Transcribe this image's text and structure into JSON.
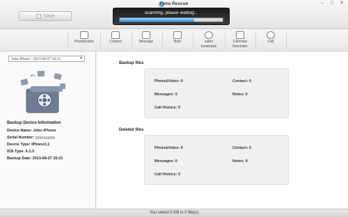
{
  "window": {
    "title": "Fone Rescue",
    "minimize": "–",
    "maximize": "□",
    "close": "✕"
  },
  "save_button": {
    "label": "Save",
    "icon": "save-icon"
  },
  "scan": {
    "status": "scanning, please waiting...",
    "progress": 0.72
  },
  "toolbar": [
    {
      "label": "Photo&video",
      "icon": "photo-video-icon"
    },
    {
      "label": "Contact",
      "icon": "contact-icon"
    },
    {
      "label": "Message",
      "icon": "message-icon"
    },
    {
      "label": "Note",
      "icon": "note-icon"
    },
    {
      "label": "safari\nbookmark",
      "icon": "safari-bookmark-icon"
    },
    {
      "label": "Calendar\nReminder",
      "icon": "calendar-icon"
    },
    {
      "label": "Call",
      "icon": "call-icon"
    }
  ],
  "device": {
    "selected": "John iPhone - 2013-08-27 16:21",
    "info_title": "Backup Device Information",
    "name_label": "Device Name:",
    "name_value": "John iPhone",
    "serial_label": "Serial Number:",
    "type_label": "Devcie Type:",
    "type_value": "iPhone3,1",
    "ios_label": "IOS Type:",
    "ios_value": "6.1.3",
    "date_label": "Backup Date:",
    "date_value": "2013-08-27 16:21"
  },
  "backup": {
    "title": "Backup files",
    "photo": "Photo&Video: 0",
    "contact": "Contact: 0",
    "messages": "Messages: 0",
    "notes": "Notes: 0",
    "call": "Call History: 0"
  },
  "deleted": {
    "title": "Deleted files",
    "photo": "Photo&Video: 0",
    "contact": "Contact: 0",
    "messages": "Messages: 0",
    "notes": "Notes: 0",
    "call": "Call History: 0"
  },
  "status": "You select 0 KB in 0 file(s)"
}
